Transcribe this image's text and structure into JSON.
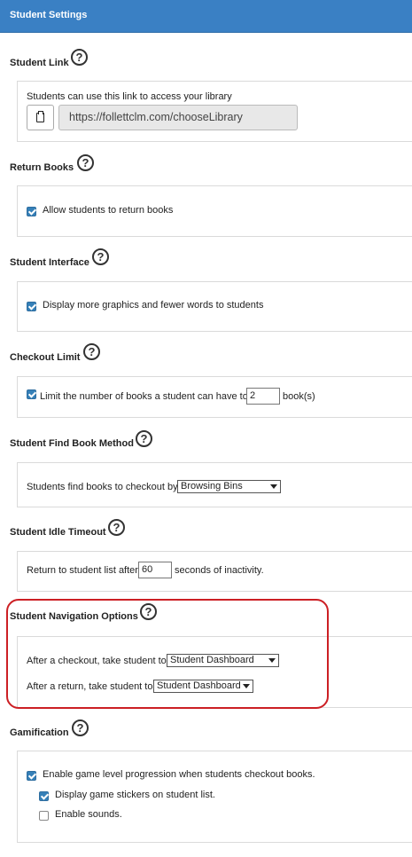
{
  "header": {
    "title": "Student Settings"
  },
  "help_glyph": "?",
  "student_link": {
    "title": "Student Link",
    "description": "Students can use this link to access your library",
    "url": "https://follettclm.com/chooseLibrary"
  },
  "return_books": {
    "title": "Return Books",
    "option": "Allow students to return books",
    "checked": true
  },
  "student_interface": {
    "title": "Student Interface",
    "option": "Display more graphics and fewer words to students",
    "checked": true
  },
  "checkout_limit": {
    "title": "Checkout Limit",
    "prefix": "Limit the number of books a student can have to",
    "value": "2",
    "suffix": "book(s)",
    "checked": true
  },
  "find_book_method": {
    "title": "Student Find Book Method",
    "prefix": "Students find books to checkout by",
    "selected": "Browsing Bins"
  },
  "idle_timeout": {
    "title": "Student Idle Timeout",
    "prefix": "Return to student list after",
    "value": "60",
    "suffix": "seconds of inactivity."
  },
  "navigation_options": {
    "title": "Student Navigation Options",
    "after_checkout_label": "After a checkout, take student to",
    "after_checkout_value": "Student Dashboard",
    "after_return_label": "After a return, take student to",
    "after_return_value": "Student Dashboard",
    "highlight_color": "#cc1f24"
  },
  "gamification": {
    "title": "Gamification",
    "enable_levels": "Enable game level progression when students checkout books.",
    "enable_levels_checked": true,
    "display_stickers": "Display game stickers on student list.",
    "display_stickers_checked": true,
    "enable_sounds": "Enable sounds.",
    "enable_sounds_checked": false
  },
  "colors": {
    "header_bg": "#3a80c4",
    "checkbox_checked": "#3580b8"
  }
}
